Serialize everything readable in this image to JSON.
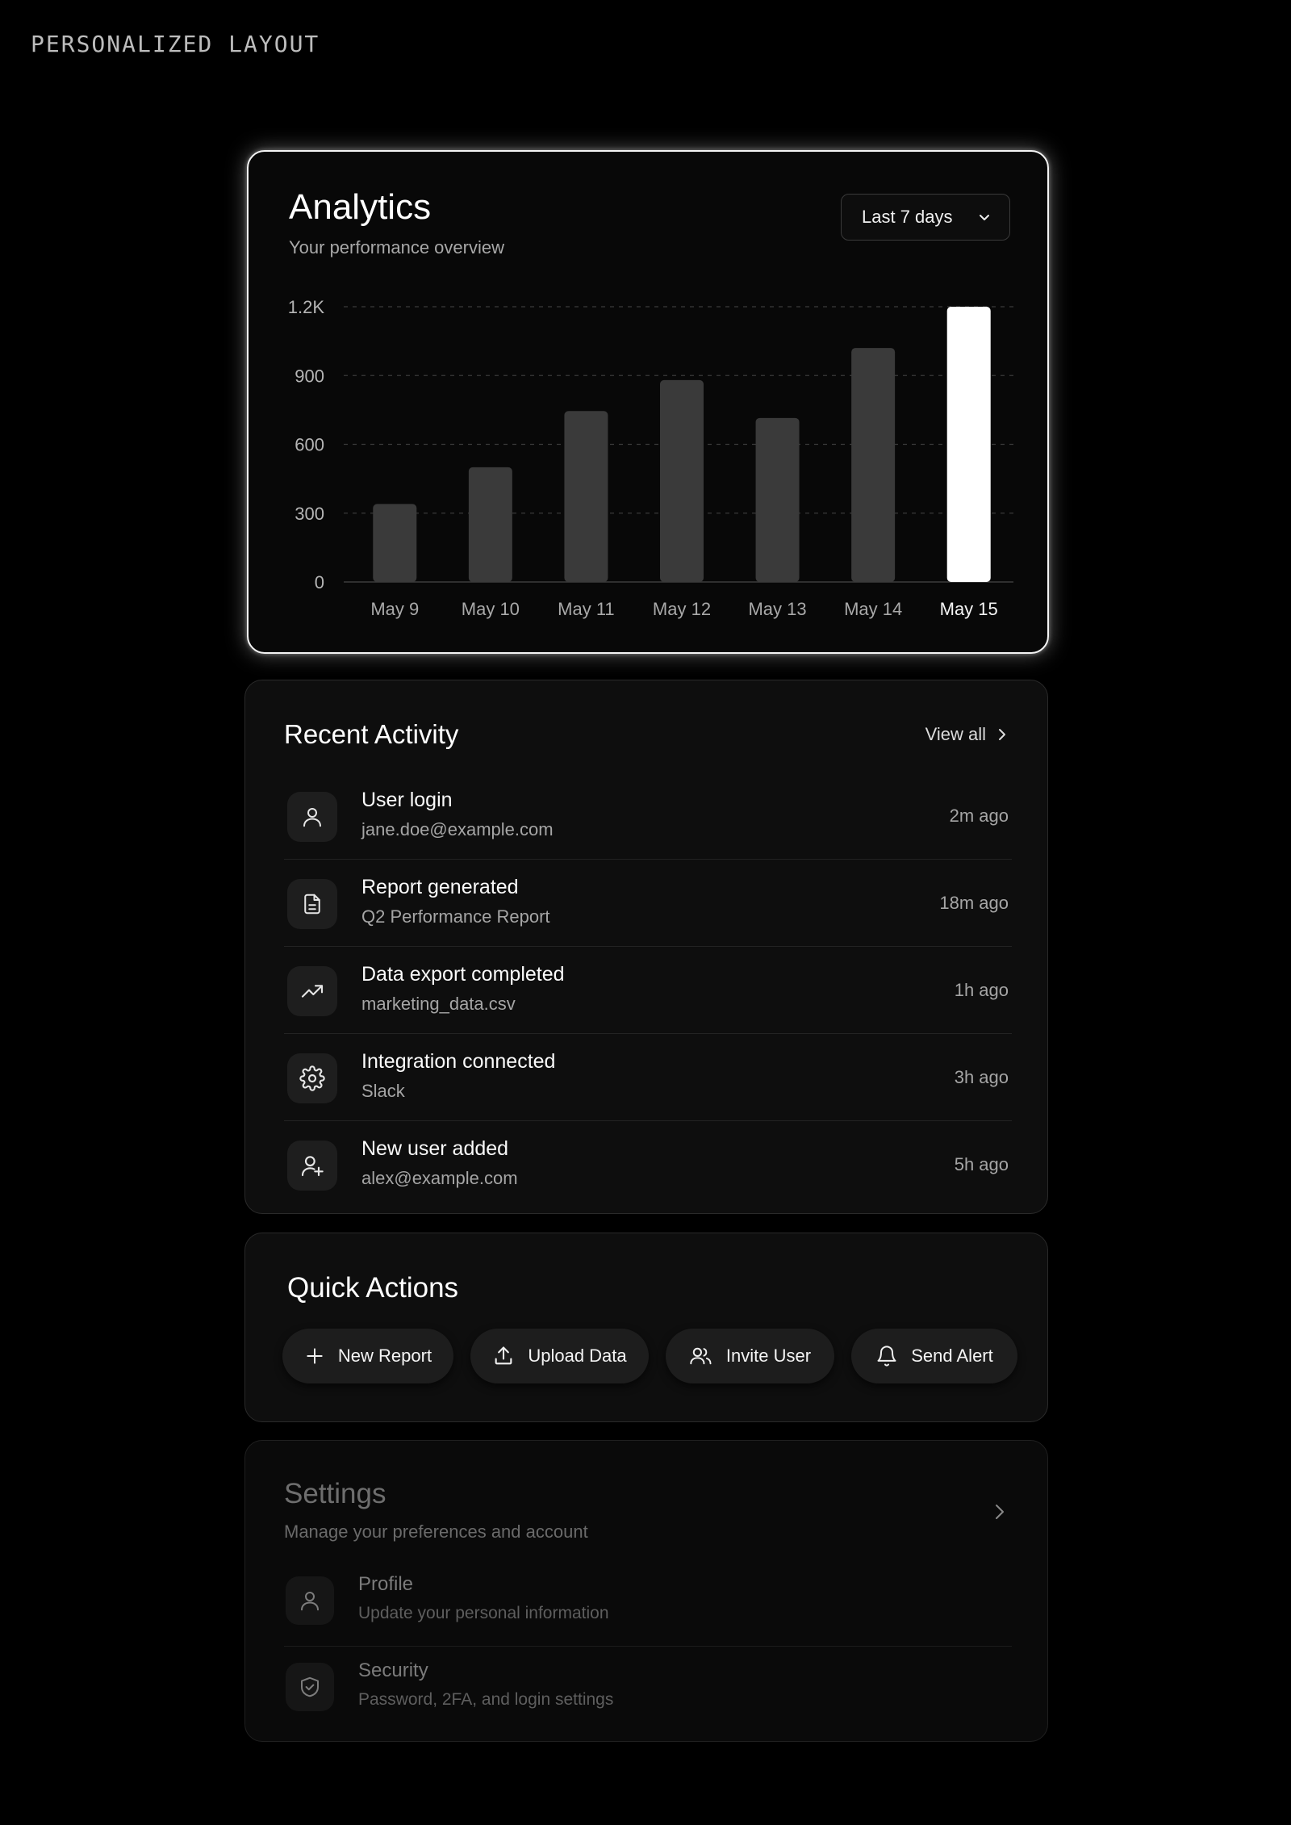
{
  "page": {
    "label": "PERSONALIZED LAYOUT"
  },
  "analytics": {
    "title": "Analytics",
    "subtitle": "Your performance overview",
    "range_select": {
      "value": "Last 7 days",
      "icon": "chevron-down-icon"
    }
  },
  "chart_data": {
    "type": "bar",
    "categories": [
      "May 9",
      "May 10",
      "May 11",
      "May 12",
      "May 13",
      "May 14",
      "May 15"
    ],
    "values": [
      340,
      500,
      745,
      880,
      715,
      1020,
      1200
    ],
    "highlighted_category": "May 15",
    "y_ticks": [
      "0",
      "300",
      "600",
      "900",
      "1.2K"
    ],
    "y_tick_values": [
      0,
      300,
      600,
      900,
      1200
    ],
    "ylim": [
      0,
      1200
    ],
    "grid": true,
    "colors": {
      "bar": "#3a3a3a",
      "highlight": "#ffffff",
      "grid": "#3a3a3a"
    }
  },
  "activity": {
    "title": "Recent Activity",
    "view_all": "View all",
    "items": [
      {
        "icon": "user-icon",
        "title": "User login",
        "detail": "jane.doe@example.com",
        "time": "2m ago"
      },
      {
        "icon": "file-text-icon",
        "title": "Report generated",
        "detail": "Q2 Performance Report",
        "time": "18m ago"
      },
      {
        "icon": "trending-up-icon",
        "title": "Data export completed",
        "detail": "marketing_data.csv",
        "time": "1h ago"
      },
      {
        "icon": "gear-icon",
        "title": "Integration connected",
        "detail": "Slack",
        "time": "3h ago"
      },
      {
        "icon": "user-plus-icon",
        "title": "New user added",
        "detail": "alex@example.com",
        "time": "5h ago"
      }
    ]
  },
  "quick_actions": {
    "title": "Quick Actions",
    "buttons": [
      {
        "icon": "plus-icon",
        "label": "New Report"
      },
      {
        "icon": "upload-icon",
        "label": "Upload Data"
      },
      {
        "icon": "users-icon",
        "label": "Invite User"
      },
      {
        "icon": "bell-icon",
        "label": "Send Alert"
      }
    ]
  },
  "settings": {
    "title": "Settings",
    "subtitle": "Manage your preferences and account",
    "items": [
      {
        "icon": "user-icon",
        "title": "Profile",
        "detail": "Update your personal information"
      },
      {
        "icon": "shield-check-icon",
        "title": "Security",
        "detail": "Password, 2FA, and login settings"
      }
    ]
  }
}
